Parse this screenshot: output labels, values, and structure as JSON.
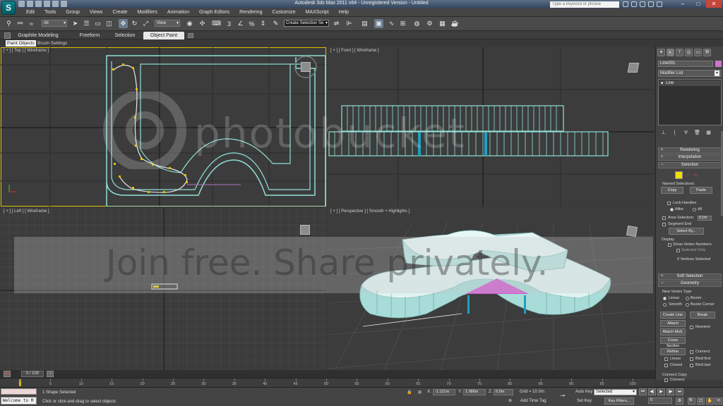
{
  "window": {
    "title": "Autodesk 3ds Max 2011 x64 - Unregistered Version - Untitled",
    "search_placeholder": "Type a keyword or phrase"
  },
  "menu": [
    "Edit",
    "Tools",
    "Group",
    "Views",
    "Create",
    "Modifiers",
    "Animation",
    "Graph Editors",
    "Rendering",
    "Customize",
    "MAXScript",
    "Help"
  ],
  "toolbar": {
    "selection_filter": "All",
    "reference_coord": "View",
    "named_selection_set": "Create Selection Se"
  },
  "ribbon": {
    "tabs": [
      "Graphite Modeling Tools",
      "Freeform",
      "Selection",
      "Object Paint"
    ],
    "active_tab": "Object Paint",
    "subtabs": [
      "Paint Objects",
      "Brush Settings"
    ]
  },
  "viewports": {
    "top": "[ + ] [ Top ] [ Wireframe ]",
    "front": "[ + ] [ Front ] [ Wireframe ]",
    "left": "[ + ] [ Left ] [ Wireframe ]",
    "perspective": "[ + ] [ Perspective ] [ Smooth + Highlights ]"
  },
  "command_panel": {
    "object_name": "Line001",
    "object_color": "#d86cd8",
    "modifier_list": "Modifier List",
    "stack_item": "Line",
    "rollouts": {
      "rendering": "Rendering",
      "interpolation": "Interpolation",
      "selection": "Selection",
      "soft_selection": "Soft Selection",
      "geometry": "Geometry"
    },
    "named_selections": "Named Selections:",
    "copy": "Copy",
    "paste": "Paste",
    "lock_handles": "Lock Handles",
    "alike": "Alike",
    "all": "All",
    "area_selection": "Area Selection:",
    "area_value": "0.1m",
    "segment_end": "Segment End",
    "select_by": "Select By...",
    "display": "Display",
    "show_vertex_numbers": "Show Vertex Numbers",
    "selected_only": "Selected Only",
    "vertices_selected": "0 Vertices Selected",
    "new_vertex_type": "New Vertex Type",
    "linear": "Linear",
    "bezier": "Bezier",
    "smooth": "Smooth",
    "bezier_corner": "Bezier Corner",
    "create_line": "Create Line",
    "break": "Break",
    "attach": "Attach",
    "reorient": "Reorient",
    "attach_mult": "Attach Mult.",
    "cross_section": "Cross Section",
    "refine": "Refine",
    "connect": "Connect",
    "linear2": "Linear",
    "bind_first": "Bind first",
    "closed": "Closed",
    "bind_last": "Bind last",
    "connect_copy": "Connect Copy",
    "connect2": "Connect"
  },
  "timeline": {
    "frame_label": "0 / 100",
    "ticks": [
      0,
      5,
      10,
      15,
      20,
      25,
      30,
      35,
      40,
      45,
      50,
      55,
      60,
      65,
      70,
      75,
      80,
      85,
      90,
      95,
      100
    ]
  },
  "status": {
    "listener_text": "Welcome to M",
    "selection_info": "1 Shape Selected",
    "prompt": "Click or click-and-drag to select objects",
    "x_label": "X:",
    "x_value": "-1.121m",
    "y_label": "Y:",
    "y_value": "1.086m",
    "z_label": "Z:",
    "z_value": "0.0m",
    "grid": "Grid = 10.0m",
    "add_time_tag": "Add Time Tag",
    "auto_key": "Auto Key",
    "key_mode": "Selected",
    "set_key": "Set Key",
    "key_filters": "Key Filters...",
    "current_frame": "0"
  },
  "watermark": {
    "top": "photobucket",
    "bottom": "Join free. Share privately."
  }
}
